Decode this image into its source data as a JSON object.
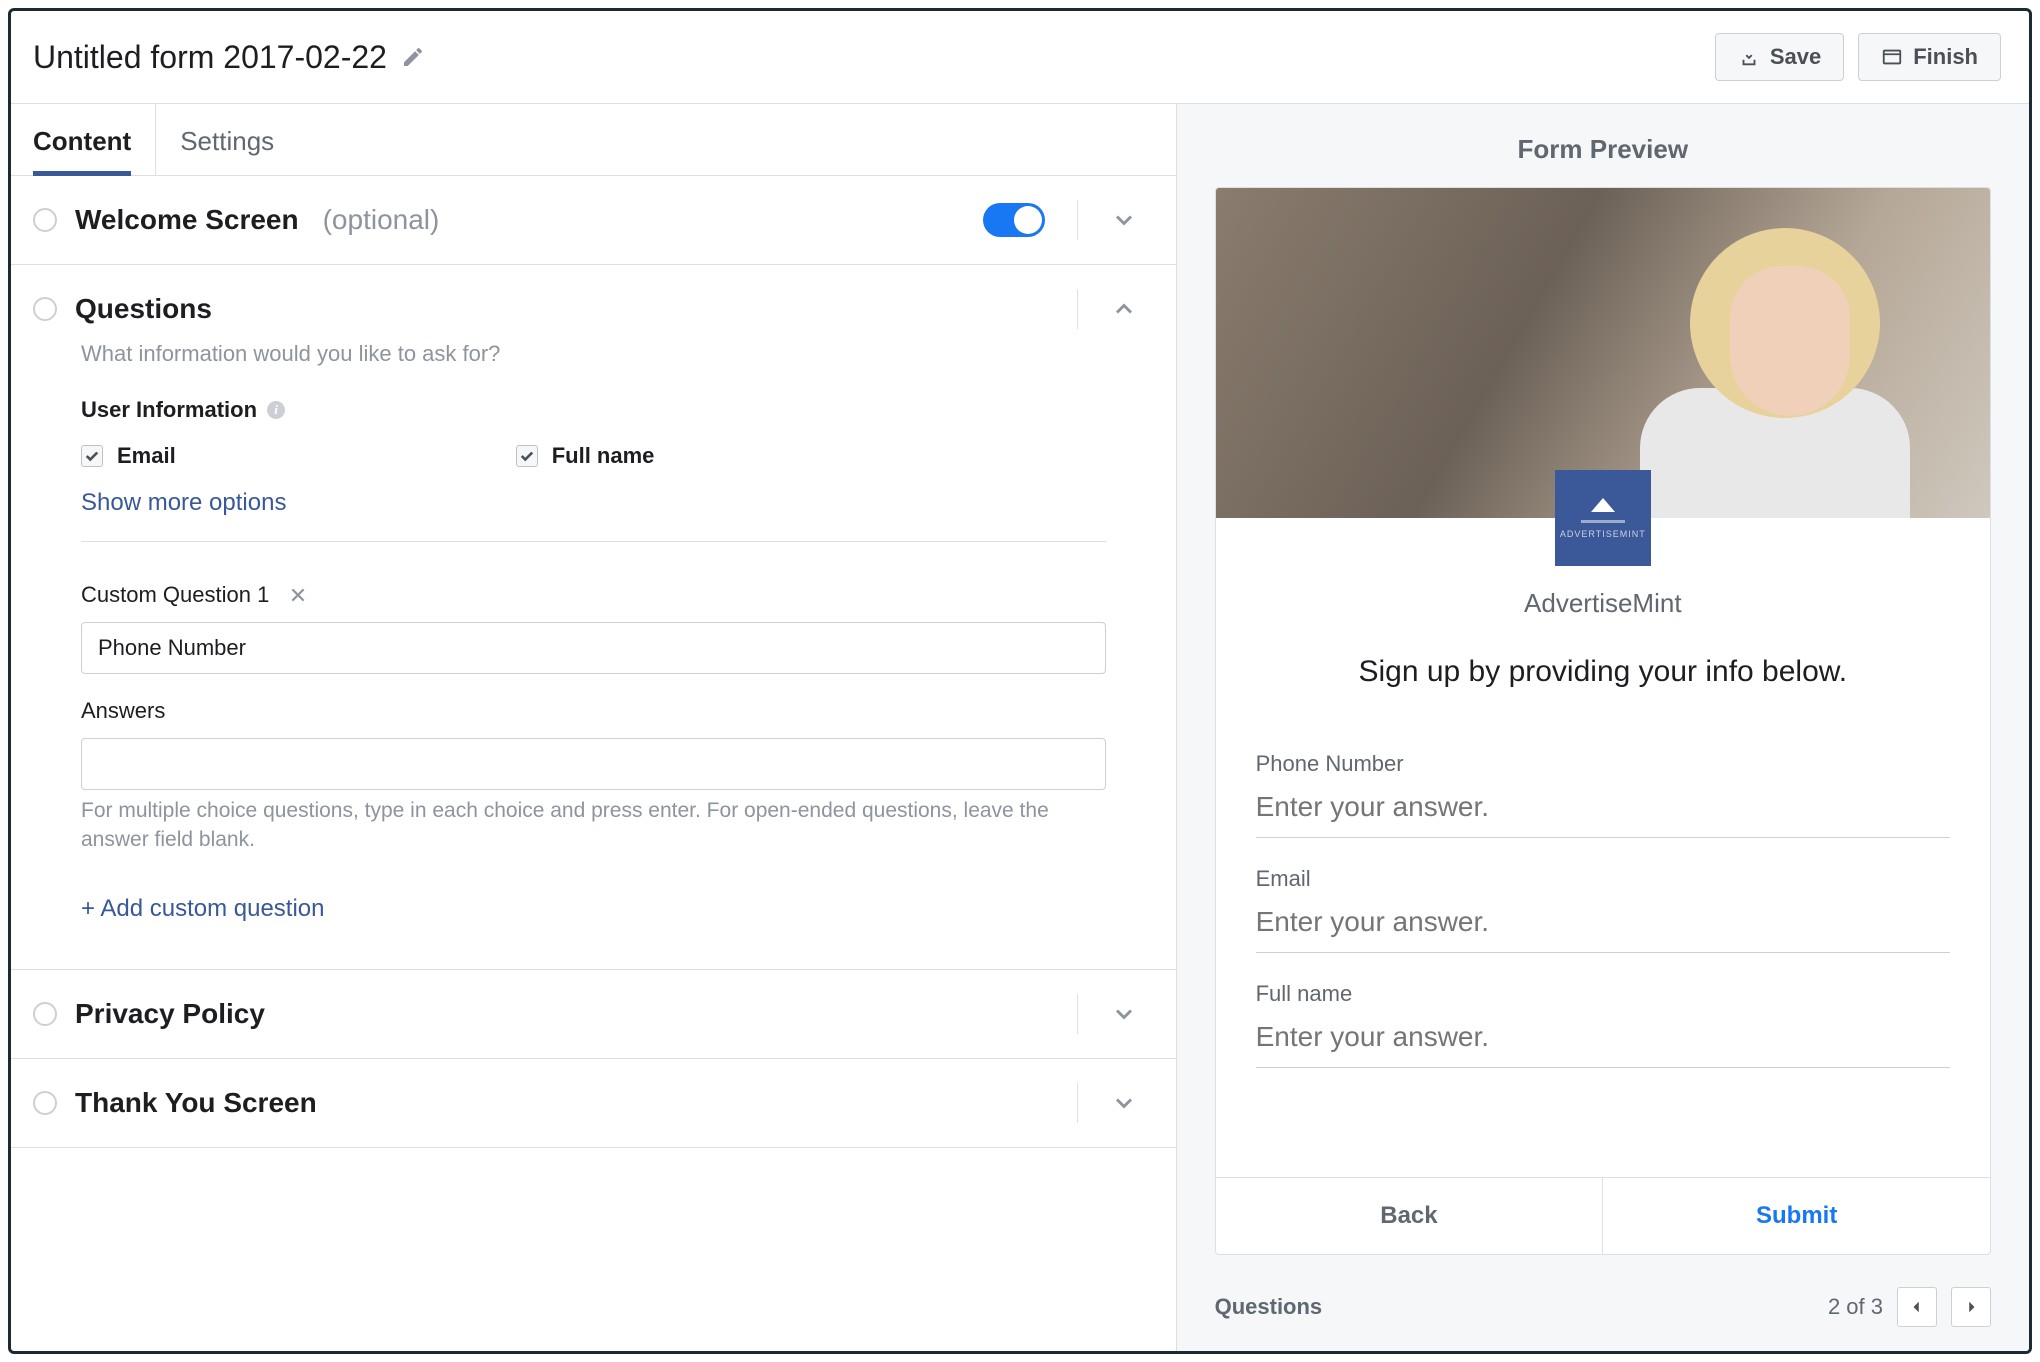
{
  "header": {
    "title": "Untitled form 2017-02-22",
    "save_label": "Save",
    "finish_label": "Finish"
  },
  "tabs": {
    "content": "Content",
    "settings": "Settings"
  },
  "welcome": {
    "title": "Welcome Screen",
    "optional": "(optional)",
    "enabled": true
  },
  "questions": {
    "title": "Questions",
    "helper": "What information would you like to ask for?",
    "user_info_label": "User Information",
    "email_label": "Email",
    "full_name_label": "Full name",
    "show_more": "Show more options",
    "custom_label": "Custom Question 1",
    "custom_value": "Phone Number",
    "answers_label": "Answers",
    "answers_hint": "For multiple choice questions, type in each choice and press enter. For open-ended questions, leave the answer field blank.",
    "add_custom": "+ Add custom question"
  },
  "privacy": {
    "title": "Privacy Policy"
  },
  "thankyou": {
    "title": "Thank You Screen"
  },
  "preview": {
    "heading": "Form Preview",
    "brand": "AdvertiseMint",
    "headline": "Sign up by providing your info below.",
    "fields": [
      {
        "label": "Phone Number",
        "placeholder": "Enter your answer."
      },
      {
        "label": "Email",
        "placeholder": "Enter your answer."
      },
      {
        "label": "Full name",
        "placeholder": "Enter your answer."
      }
    ],
    "back": "Back",
    "submit": "Submit",
    "footer_label": "Questions",
    "page_indicator": "2 of 3"
  }
}
